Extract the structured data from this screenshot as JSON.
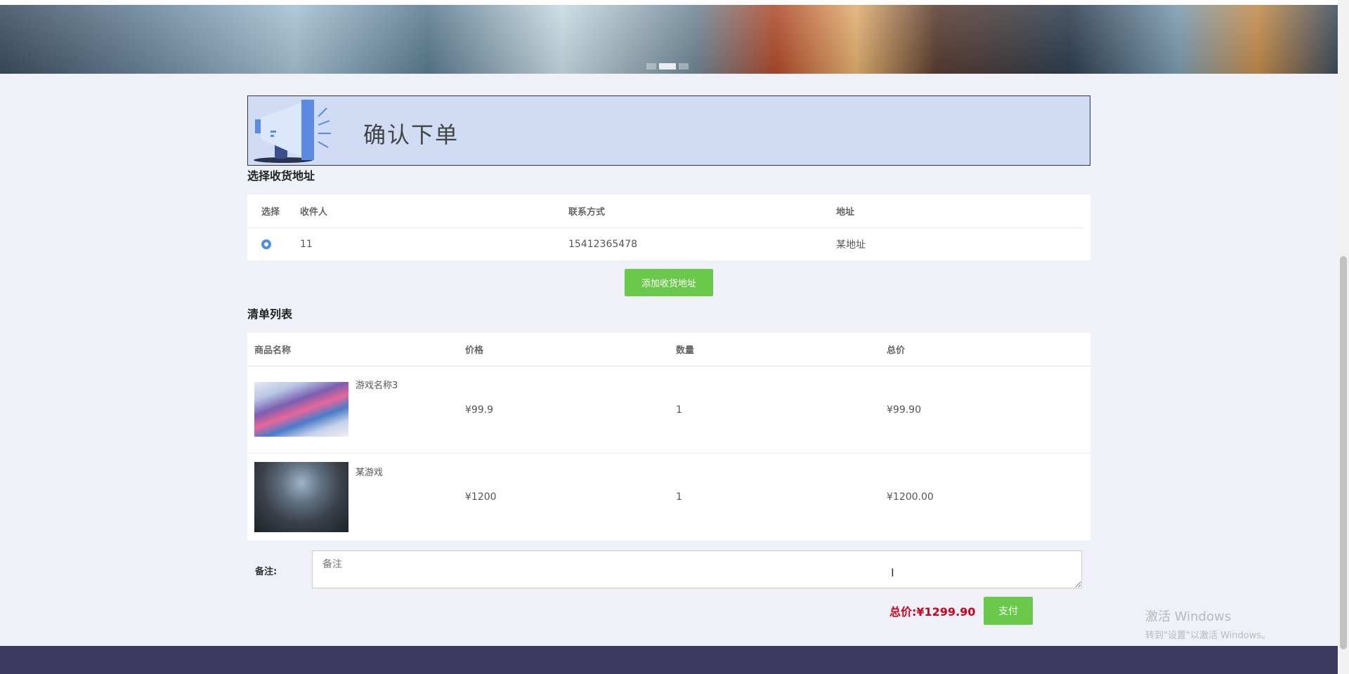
{
  "page": {
    "title": "确认下单"
  },
  "address_section": {
    "heading": "选择收货地址",
    "columns": [
      "选择",
      "收件人",
      "联系方式",
      "地址"
    ],
    "rows": [
      {
        "selected": true,
        "recipient": "11",
        "phone": "15412365478",
        "address": "某地址"
      }
    ],
    "add_button_label": "添加收货地址"
  },
  "order_list": {
    "heading": "清单列表",
    "columns": [
      "商品名称",
      "价格",
      "数量",
      "总价"
    ],
    "items": [
      {
        "name": "游戏名称3",
        "price": "¥99.9",
        "quantity": "1",
        "subtotal": "¥99.90"
      },
      {
        "name": "某游戏",
        "price": "¥1200",
        "quantity": "1",
        "subtotal": "¥1200.00"
      }
    ]
  },
  "remark": {
    "label": "备注:",
    "placeholder": "备注",
    "value": ""
  },
  "checkout": {
    "total_text": "总价:¥1299.90",
    "pay_button_label": "支付"
  },
  "watermark": {
    "line1": "激活 Windows",
    "line2": "转到\"设置\"以激活 Windows。"
  },
  "colors": {
    "accent_green": "#6ac94a",
    "total_red": "#d0021b",
    "title_bg": "#cfdcf3",
    "footer_bg": "#3c3a5e"
  },
  "icons": [
    "megaphone-icon",
    "radio-selected-icon",
    "text-cursor-icon"
  ]
}
